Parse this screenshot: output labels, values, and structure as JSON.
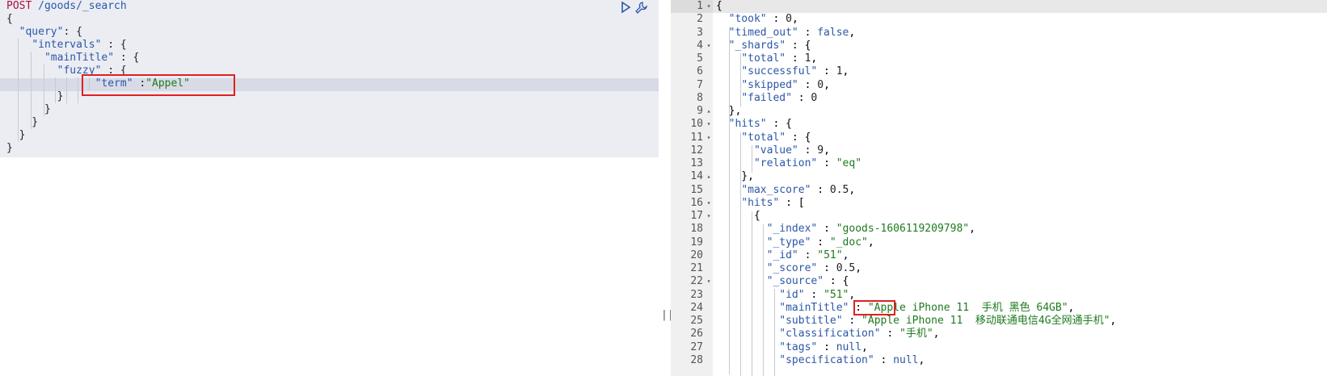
{
  "request": {
    "method": "POST",
    "path": " /goods/_search",
    "lines": [
      {
        "t": "{"
      },
      {
        "t": "  \"query\": {"
      },
      {
        "t": "    \"intervals\" : {"
      },
      {
        "t": "      \"mainTitle\" : {"
      },
      {
        "t": "        \"fuzzy\" : {"
      },
      {
        "t": "              \"term\" :\"Appel\""
      },
      {
        "t": "        }"
      },
      {
        "t": "      }"
      },
      {
        "t": "    }"
      },
      {
        "t": "  }"
      },
      {
        "t": "}"
      }
    ],
    "run_icon": "play-icon",
    "wrench_icon": "wrench-icon"
  },
  "splitter_icon": "||",
  "response": {
    "lines": [
      {
        "n": "1",
        "fold": "▾",
        "code": "{"
      },
      {
        "n": "2",
        "fold": "",
        "code": "  \"took\" : 0,"
      },
      {
        "n": "3",
        "fold": "",
        "code": "  \"timed_out\" : false,"
      },
      {
        "n": "4",
        "fold": "▾",
        "code": "  \"_shards\" : {"
      },
      {
        "n": "5",
        "fold": "",
        "code": "    \"total\" : 1,"
      },
      {
        "n": "6",
        "fold": "",
        "code": "    \"successful\" : 1,"
      },
      {
        "n": "7",
        "fold": "",
        "code": "    \"skipped\" : 0,"
      },
      {
        "n": "8",
        "fold": "",
        "code": "    \"failed\" : 0"
      },
      {
        "n": "9",
        "fold": "▴",
        "code": "  },"
      },
      {
        "n": "10",
        "fold": "▾",
        "code": "  \"hits\" : {"
      },
      {
        "n": "11",
        "fold": "▾",
        "code": "    \"total\" : {"
      },
      {
        "n": "12",
        "fold": "",
        "code": "      \"value\" : 9,"
      },
      {
        "n": "13",
        "fold": "",
        "code": "      \"relation\" : \"eq\""
      },
      {
        "n": "14",
        "fold": "▴",
        "code": "    },"
      },
      {
        "n": "15",
        "fold": "",
        "code": "    \"max_score\" : 0.5,"
      },
      {
        "n": "16",
        "fold": "▾",
        "code": "    \"hits\" : ["
      },
      {
        "n": "17",
        "fold": "▾",
        "code": "      {"
      },
      {
        "n": "18",
        "fold": "",
        "code": "        \"_index\" : \"goods-1606119209798\","
      },
      {
        "n": "19",
        "fold": "",
        "code": "        \"_type\" : \"_doc\","
      },
      {
        "n": "20",
        "fold": "",
        "code": "        \"_id\" : \"51\","
      },
      {
        "n": "21",
        "fold": "",
        "code": "        \"_score\" : 0.5,"
      },
      {
        "n": "22",
        "fold": "▾",
        "code": "        \"_source\" : {"
      },
      {
        "n": "23",
        "fold": "",
        "code": "          \"id\" : \"51\","
      },
      {
        "n": "24",
        "fold": "",
        "code": "          \"mainTitle\" : \"Apple iPhone 11  手机 黑色 64GB\","
      },
      {
        "n": "25",
        "fold": "",
        "code": "          \"subtitle\" : \"Apple iPhone 11  移动联通电信4G全网通手机\","
      },
      {
        "n": "26",
        "fold": "",
        "code": "          \"classification\" : \"手机\","
      },
      {
        "n": "27",
        "fold": "",
        "code": "          \"tags\" : null,"
      },
      {
        "n": "28",
        "fold": "",
        "code": "          \"specification\" : null,"
      }
    ]
  }
}
